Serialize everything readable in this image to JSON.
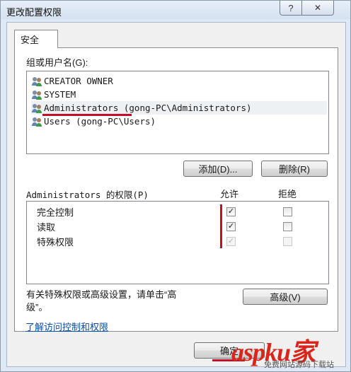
{
  "window": {
    "title": "更改配置权限",
    "help_glyph": "?",
    "close_glyph": "✕"
  },
  "tabs": [
    {
      "label": "安全"
    }
  ],
  "group": {
    "label": "组或用户名(G):",
    "users": [
      {
        "name": "CREATOR OWNER",
        "icon": "users-icon",
        "selected": false
      },
      {
        "name": "SYSTEM",
        "icon": "users-icon",
        "selected": false
      },
      {
        "name": "Administrators (gong-PC\\Administrators)",
        "icon": "users-icon",
        "selected": true
      },
      {
        "name": "Users (gong-PC\\Users)",
        "icon": "users-icon",
        "selected": false
      }
    ],
    "add_label": "添加(D)...",
    "remove_label": "删除(R)"
  },
  "permissions": {
    "label": "Administrators 的权限(P)",
    "allow_header": "允许",
    "deny_header": "拒绝",
    "rows": [
      {
        "name": "完全控制",
        "allow": true,
        "deny": false,
        "disabled": false
      },
      {
        "name": "读取",
        "allow": true,
        "deny": false,
        "disabled": false
      },
      {
        "name": "特殊权限",
        "allow": true,
        "deny": false,
        "disabled": true
      }
    ]
  },
  "advanced": {
    "note_line1": "有关特殊权限或高级设置，请单击“高",
    "note_line2": "级”。",
    "button_label": "高级(V)"
  },
  "help_link": "了解访问控制和权限",
  "footer": {
    "ok_label": "确定"
  },
  "watermark": {
    "brand": "aspku家",
    "sub": "免费网站源码下载站"
  },
  "colors": {
    "annotation_red": "#c0102a",
    "link_blue": "#0a4fa8",
    "selection": "#eef1f4"
  }
}
